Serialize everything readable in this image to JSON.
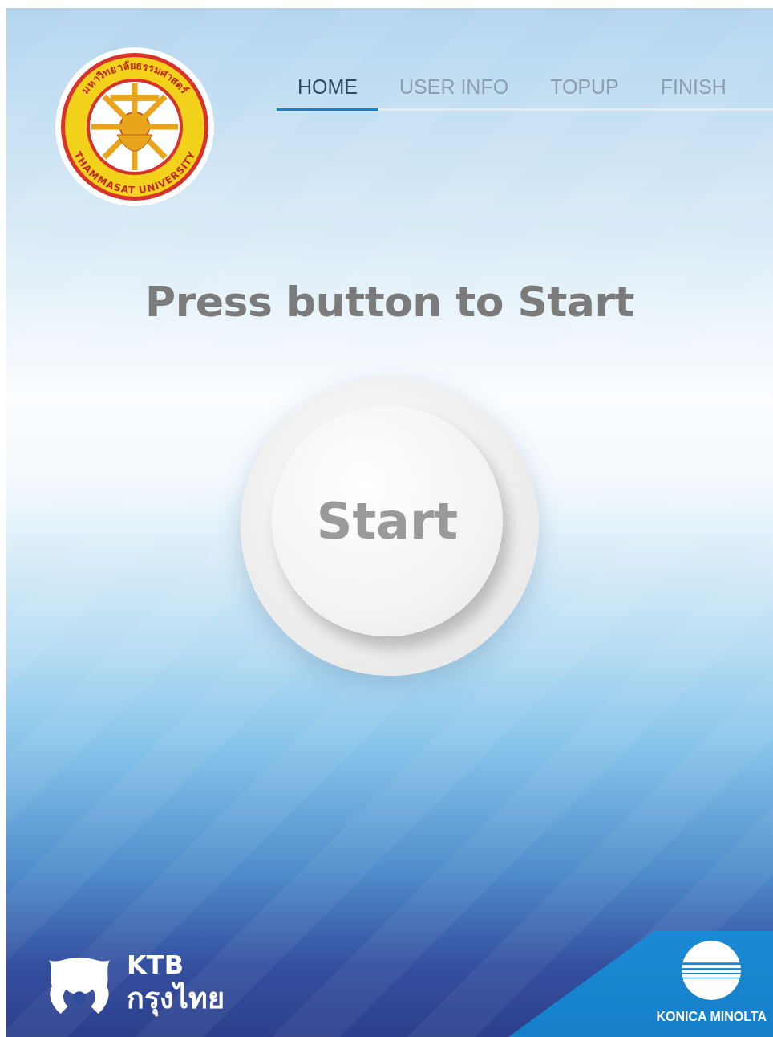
{
  "seal": {
    "thai_text": "มหาวิทยาลัยธรรมศาสตร์",
    "english_text": "THAMMASAT UNIVERSITY"
  },
  "tabs": [
    {
      "label": "HOME",
      "selected": true
    },
    {
      "label": "USER INFO",
      "selected": false
    },
    {
      "label": "TOPUP",
      "selected": false
    },
    {
      "label": "FINISH",
      "selected": false
    }
  ],
  "heading": "Press button to Start",
  "start_button": {
    "label": "Start"
  },
  "bank_logo": {
    "abbreviation": "KTB",
    "thai_name": "กรุงไทย"
  },
  "partner_logo": {
    "name": "KONICA MINOLTA"
  }
}
